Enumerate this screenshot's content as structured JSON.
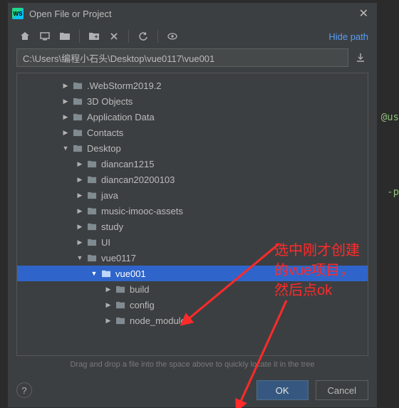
{
  "window": {
    "title": "Open File or Project"
  },
  "toolbar": {
    "hide_path": "Hide path"
  },
  "path": {
    "value": "C:\\Users\\编程小石头\\Desktop\\vue0117\\vue001"
  },
  "tree": {
    "rows": [
      {
        "indent": 3,
        "expander": "right",
        "label": ".WebStorm2019.2",
        "selected": false
      },
      {
        "indent": 3,
        "expander": "right",
        "label": "3D Objects",
        "selected": false
      },
      {
        "indent": 3,
        "expander": "right",
        "label": "Application Data",
        "selected": false
      },
      {
        "indent": 3,
        "expander": "right",
        "label": "Contacts",
        "selected": false
      },
      {
        "indent": 3,
        "expander": "down",
        "label": "Desktop",
        "selected": false
      },
      {
        "indent": 4,
        "expander": "right",
        "label": "diancan1215",
        "selected": false
      },
      {
        "indent": 4,
        "expander": "right",
        "label": "diancan20200103",
        "selected": false
      },
      {
        "indent": 4,
        "expander": "right",
        "label": "java",
        "selected": false
      },
      {
        "indent": 4,
        "expander": "right",
        "label": "music-imooc-assets",
        "selected": false
      },
      {
        "indent": 4,
        "expander": "right",
        "label": "study",
        "selected": false
      },
      {
        "indent": 4,
        "expander": "right",
        "label": "UI",
        "selected": false
      },
      {
        "indent": 4,
        "expander": "down",
        "label": "vue0117",
        "selected": false
      },
      {
        "indent": 5,
        "expander": "down",
        "label": "vue001",
        "selected": true
      },
      {
        "indent": 6,
        "expander": "right",
        "label": "build",
        "selected": false
      },
      {
        "indent": 6,
        "expander": "right",
        "label": "config",
        "selected": false
      },
      {
        "indent": 6,
        "expander": "right",
        "label": "node_modules",
        "selected": false
      }
    ]
  },
  "hint": "Drag and drop a file into the space above to quickly locate it in the tree",
  "footer": {
    "ok": "OK",
    "cancel": "Cancel"
  },
  "annotation": {
    "line1": "选中刚才创建",
    "line2": "的vue项目，",
    "line3": "然后点ok"
  },
  "bg": {
    "at": "@us",
    "p": "-p"
  },
  "icons": {
    "folder_svg": "<path fill='currentColor' d='M1 2h5l1 1h7v9H1z' opacity='0.9'/>"
  }
}
